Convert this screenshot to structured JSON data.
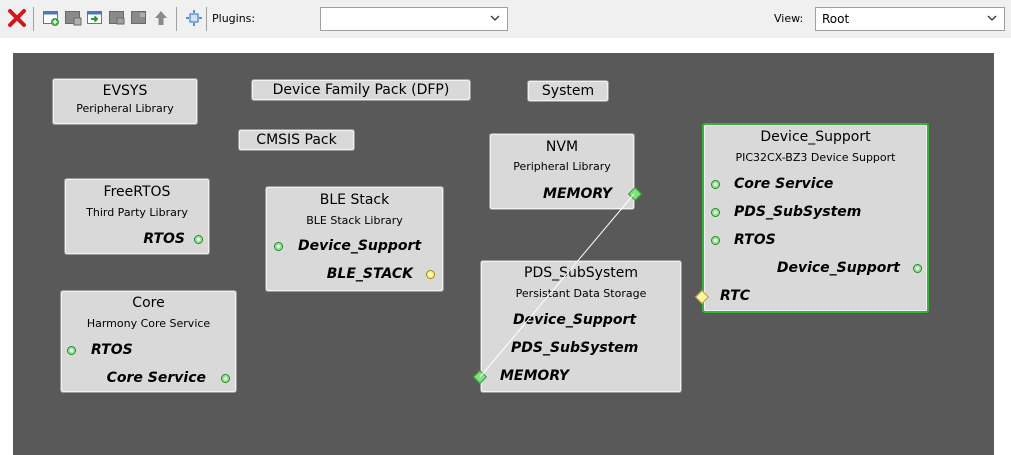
{
  "toolbar": {
    "plugins_label": "Plugins:",
    "plugins_value": "",
    "view_label": "View:",
    "view_value": "Root"
  },
  "colors": {
    "canvas_bg": "#595959",
    "node_bg": "#d9d9d9",
    "selected_border": "#3ab03a",
    "port_green": "#7de37d",
    "port_yellow": "#fff5a0"
  },
  "nodes": {
    "evsys": {
      "title": "EVSYS",
      "subtitle": "Peripheral Library"
    },
    "dfp": {
      "title": "Device Family Pack (DFP)"
    },
    "system": {
      "title": "System"
    },
    "cmsis": {
      "title": "CMSIS Pack"
    },
    "nvm": {
      "title": "NVM",
      "subtitle": "Peripheral Library",
      "ports": [
        "MEMORY"
      ]
    },
    "device_support": {
      "title": "Device_Support",
      "subtitle": "PIC32CX-BZ3 Device Support",
      "ports": [
        "Core Service",
        "PDS_SubSystem",
        "RTOS",
        "Device_Support",
        "RTC"
      ]
    },
    "freertos": {
      "title": "FreeRTOS",
      "subtitle": "Third Party Library",
      "ports": [
        "RTOS"
      ]
    },
    "ble_stack": {
      "title": "BLE Stack",
      "subtitle": "BLE Stack Library",
      "ports": [
        "Device_Support",
        "BLE_STACK"
      ]
    },
    "pds": {
      "title": "PDS_SubSystem",
      "subtitle": "Persistant Data Storage",
      "ports": [
        "Device_Support",
        "PDS_SubSystem",
        "MEMORY"
      ]
    },
    "core": {
      "title": "Core",
      "subtitle": "Harmony Core Service",
      "ports": [
        "RTOS",
        "Core Service"
      ]
    }
  }
}
